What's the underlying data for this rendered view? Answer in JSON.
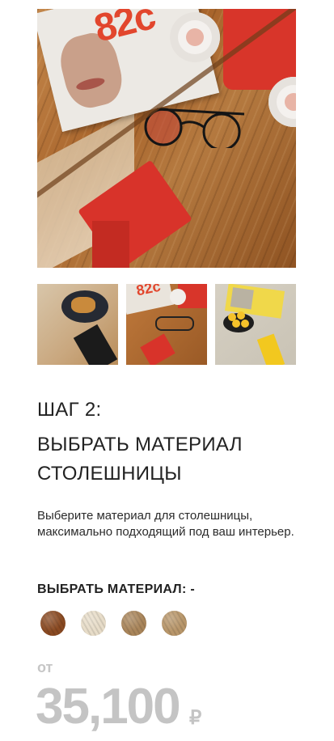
{
  "gallery": {
    "main_image": "hero-table-photo",
    "hero_magazine_text": "82c",
    "thumbnails": [
      "thumb-waffles",
      "thumb-red-leg",
      "thumb-yellow-leg"
    ],
    "thumb2_magazine_text": "82c"
  },
  "step": {
    "label": "ШАГ 2:",
    "title_line1": "ВЫБРАТЬ МАТЕРИАЛ",
    "title_line2": "СТОЛЕШНИЦЫ",
    "description": "Выберите материал для столешницы, максимально подходящий под ваш интерьер."
  },
  "material": {
    "label": "ВЫБРАТЬ МАТЕРИАЛ: -",
    "swatches": [
      {
        "name": "wood-dark",
        "color": "#8a4a22"
      },
      {
        "name": "wood-light",
        "color": "#e7dcc8"
      },
      {
        "name": "wood-oak",
        "color": "#a9855a"
      },
      {
        "name": "wood-natural",
        "color": "#b8966a"
      }
    ]
  },
  "price": {
    "from": "от",
    "value": "35,100",
    "currency": "₽"
  }
}
